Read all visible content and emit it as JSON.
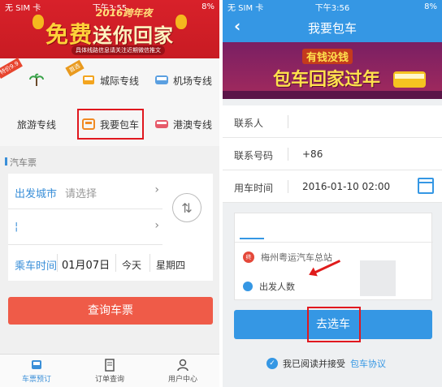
{
  "left": {
    "status": {
      "carrier": "无 SIM 卡",
      "time": "下午3:55",
      "battery": "8%"
    },
    "banner": {
      "title": "2016跨年夜",
      "headline_prefix": "免费",
      "headline_rest": "送你回家",
      "note": "具体线路信息请关注近期微信推文"
    },
    "grid": {
      "tag1": "特价9.9",
      "tag2": "首选",
      "items": [
        "城际专线",
        "机场专线",
        "旅游专线",
        "我要包车",
        "港澳专线"
      ]
    },
    "section_label": "汽车票",
    "form": {
      "from_label": "出发城市",
      "from_placeholder": "请选择",
      "date_label": "乘车时间",
      "date_value": "01月07日",
      "day_label": "今天",
      "weekday": "星期四"
    },
    "query_button": "查询车票",
    "tabs": [
      "车票预订",
      "订单查询",
      "用户中心"
    ],
    "colors": {
      "banner": "#c81b23",
      "accent": "#3a8fd8",
      "query": "#ef5b48"
    }
  },
  "right": {
    "status": {
      "carrier": "无 SIM 卡",
      "time": "下午3:56",
      "battery": "8%"
    },
    "header_title": "我要包车",
    "banner": {
      "tagline": "有钱没钱",
      "headline": "包车回家过年"
    },
    "form": {
      "contact_label": "联系人",
      "phone_label": "联系号码",
      "phone_value": "+86",
      "time_label": "用车时间",
      "time_value": "2016-01-10 02:00"
    },
    "overlay": {
      "station": "梅州粤运汽车总站",
      "station_badge": "终",
      "people_label": "出发人数"
    },
    "select_button": "去选车",
    "agreement": {
      "text": "我已阅读并接受",
      "link": "包车协议"
    },
    "colors": {
      "header": "#3597e4",
      "highlight": "#e0181f"
    }
  }
}
